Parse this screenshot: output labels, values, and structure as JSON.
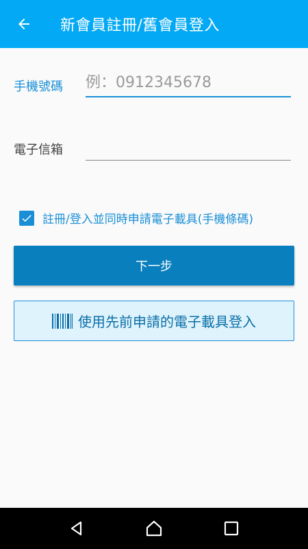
{
  "appbar": {
    "title": "新會員註冊/舊會員登入",
    "back_icon": "arrow-left-icon"
  },
  "form": {
    "phone": {
      "label": "手機號碼",
      "value": "",
      "placeholder": "例：0912345678"
    },
    "email": {
      "label": "電子信箱",
      "value": "",
      "placeholder": ""
    },
    "apply_carrier": {
      "label": "註冊/登入並同時申請電子載具(手機條碼)",
      "checked": true
    }
  },
  "buttons": {
    "next_label": "下一步",
    "carrier_login_label": "使用先前申請的電子載具登入"
  },
  "colors": {
    "appbar": "#03a9f4",
    "accent": "#1a8fd6",
    "primary_button": "#0a7fbd",
    "secondary_button_bg": "#dff3fc"
  },
  "navbar": {
    "back_icon": "nav-back-triangle-icon",
    "home_icon": "nav-home-icon",
    "recents_icon": "nav-recents-square-icon"
  }
}
